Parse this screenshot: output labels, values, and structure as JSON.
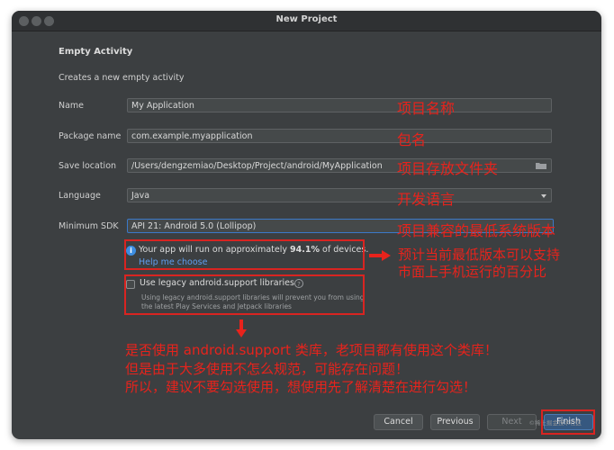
{
  "window": {
    "title": "New Project"
  },
  "section": {
    "title": "Empty Activity",
    "description": "Creates a new empty activity"
  },
  "form": {
    "name_label": "Name",
    "name_value": "My Application",
    "package_label": "Package name",
    "package_value": "com.example.myapplication",
    "save_label": "Save location",
    "save_value": "/Users/dengzemiao/Desktop/Project/android/MyApplication",
    "language_label": "Language",
    "language_value": "Java",
    "min_sdk_label": "Minimum SDK",
    "min_sdk_value": "API 21: Android 5.0 (Lollipop)"
  },
  "info": {
    "prefix": "Your app will run on approximately ",
    "percent": "94.1%",
    "suffix": " of devices.",
    "help_link": "Help me choose"
  },
  "legacy": {
    "label": "Use legacy android.support libraries",
    "description": "Using legacy android.support libraries will prevent you from using the latest Play Services and Jetpack libraries",
    "checked": false
  },
  "buttons": {
    "cancel": "Cancel",
    "previous": "Previous",
    "next": "Next",
    "finish": "Finish"
  },
  "annotations": {
    "name": "项目名称",
    "package": "包名",
    "save": "项目存放文件夹",
    "language": "开发语言",
    "sdk": "项目兼容的最低系统版本",
    "percent_line1": "预计当前最低版本可以支持",
    "percent_line2": "市面上手机运行的百分比",
    "legacy_line1": "是否使用 android.support 类库，老项目都有使用这个类库！",
    "legacy_line2": "但是由于大多使用不怎么规范，可能存在问题！",
    "legacy_line3": "所以，建议不要勾选使用，想使用先了解清楚在进行勾选！",
    "color": "#e8231c"
  },
  "icons": {
    "info": "info-icon",
    "help": "question-icon",
    "folder": "folder-icon",
    "dropdown": "chevron-down-icon",
    "arrow_right": "arrow-right-icon",
    "arrow_down": "arrow-down-icon"
  }
}
